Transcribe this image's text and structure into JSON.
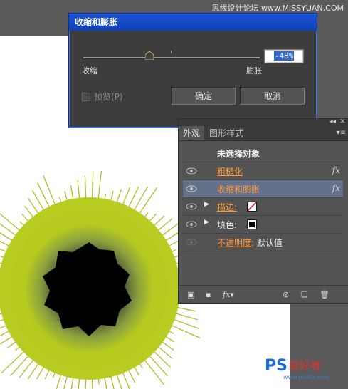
{
  "watermark_top": "思缘设计论坛 www.MISSYUAN.COM",
  "watermark_bottom": {
    "brand": "PS爱好者",
    "url": "www.psahz.com"
  },
  "dialog": {
    "title": "收缩和膨胀",
    "slider": {
      "left_label": "收缩",
      "right_label": "膨胀",
      "value": "-48%",
      "level_percent": -48
    },
    "preview_label": "预览(P)",
    "ok_label": "确定",
    "cancel_label": "取消"
  },
  "panel": {
    "tabs": [
      {
        "label": "外观"
      },
      {
        "label": "图形样式"
      }
    ],
    "header": "未选择对象",
    "effects": [
      {
        "label": "粗糙化",
        "fx": "fx"
      },
      {
        "label": "收缩和膨胀",
        "fx": "fx"
      }
    ],
    "stroke_label": "描边:",
    "fill_label": "填色:",
    "opacity_label": "不透明度:",
    "opacity_value": "默认值"
  },
  "colors": {
    "artwork_green": "#b5c91f",
    "artwork_center": "#000000",
    "selection": "#65708a",
    "dialog_title": "#1c56d8"
  }
}
